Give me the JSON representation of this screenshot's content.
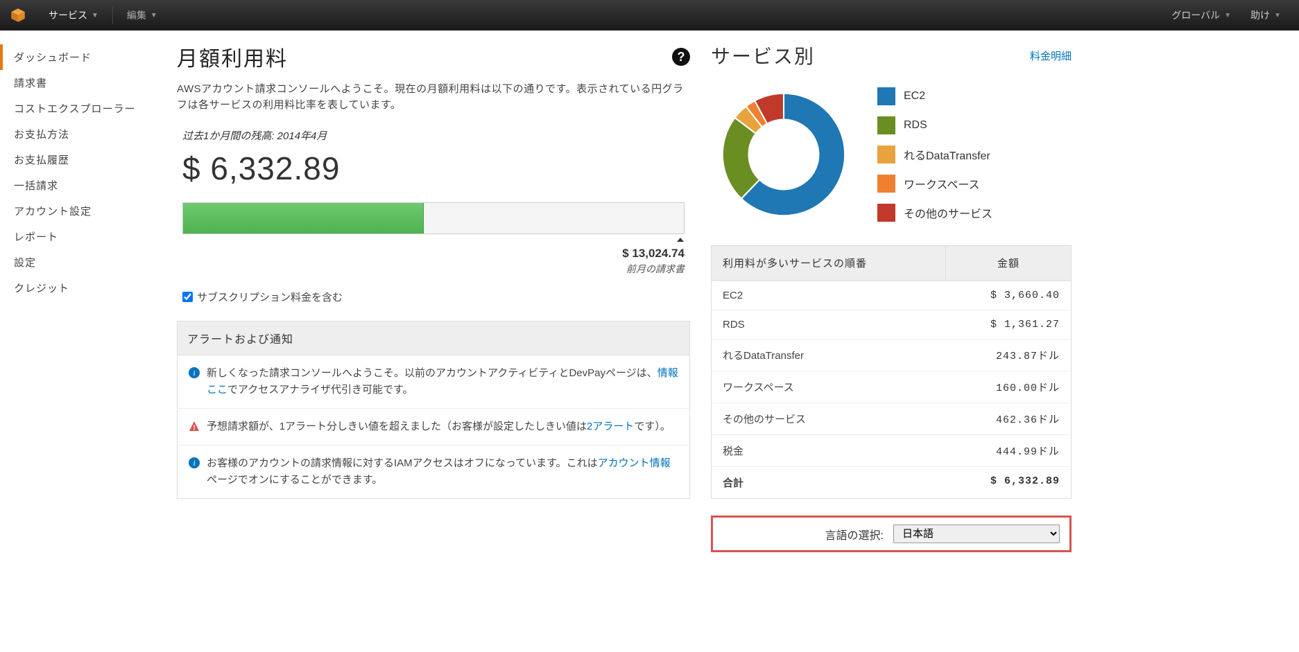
{
  "topbar": {
    "services": "サービス",
    "edit": "編集",
    "global": "グローバル",
    "help": "助け"
  },
  "sidebar": {
    "items": [
      "ダッシュボード",
      "請求書",
      "コストエクスプローラー",
      "お支払方法",
      "お支払履歴",
      "一括請求",
      "アカウント設定",
      "レポート",
      "設定",
      "クレジット"
    ]
  },
  "page": {
    "title": "月額利用料",
    "intro": "AWSアカウント請求コンソールへようこそ。現在の月額利用料は以下の通りです。表示されている円グラフは各サービスの利用料比率を表しています。"
  },
  "balance": {
    "caption": "过去1か月間の残高: 2014年4月",
    "amount": "$ 6,332.89",
    "prev_amount": "$ 13,024.74",
    "prev_label": "前月の請求書",
    "progress_pct": 48,
    "checkbox_label": "サブスクリプション料金を含む"
  },
  "alerts": {
    "header": "アラートおよび通知",
    "items": [
      {
        "type": "info",
        "text_pre": "新しくなった請求コンソールへようこそ。以前のアカウントアクティビティとDevPayページは、",
        "link": "情報ここ",
        "text_post": "でアクセスアナライザ代引き可能です。"
      },
      {
        "type": "warn",
        "text_pre": "予想請求額が、1アラート分しきい値を超えました（お客様が設定したしきい値は",
        "link": "2アラート",
        "text_post": "です）。"
      },
      {
        "type": "info",
        "text_pre": "お客様のアカウントの請求情報に対するIAMアクセスはオフになっています。これは",
        "link": "アカウント情報",
        "text_post": "ページでオンにすることができます。"
      }
    ]
  },
  "right": {
    "title": "サービス別",
    "detail_link": "料金明細",
    "table_hdr_service": "利用料が多いサービスの順番",
    "table_hdr_amount": "金額"
  },
  "chart_data": {
    "type": "pie",
    "title": "サービス別",
    "series": [
      {
        "name": "EC2",
        "value": 3660.4,
        "color": "#1f77b4"
      },
      {
        "name": "RDS",
        "value": 1361.27,
        "color": "#6b8e23"
      },
      {
        "name": "れるDataTransfer",
        "value": 243.87,
        "color": "#e8a33d"
      },
      {
        "name": "ワークスペース",
        "value": 160.0,
        "color": "#f08030"
      },
      {
        "name": "その他のサービス",
        "value": 462.36,
        "color": "#c0392b"
      }
    ]
  },
  "table": {
    "rows": [
      {
        "name": "EC2",
        "amount": "$ 3,660.40"
      },
      {
        "name": "RDS",
        "amount": "$ 1,361.27"
      },
      {
        "name": "れるDataTransfer",
        "amount": "243.87ドル"
      },
      {
        "name": "ワークスペース",
        "amount": "160.00ドル"
      },
      {
        "name": "その他のサービス",
        "amount": "462.36ドル"
      },
      {
        "name": "税金",
        "amount": "444.99ドル"
      }
    ],
    "total_label": "合計",
    "total_amount": "$ 6,332.89"
  },
  "lang": {
    "label": "言語の選択:",
    "selected": "日本語"
  }
}
